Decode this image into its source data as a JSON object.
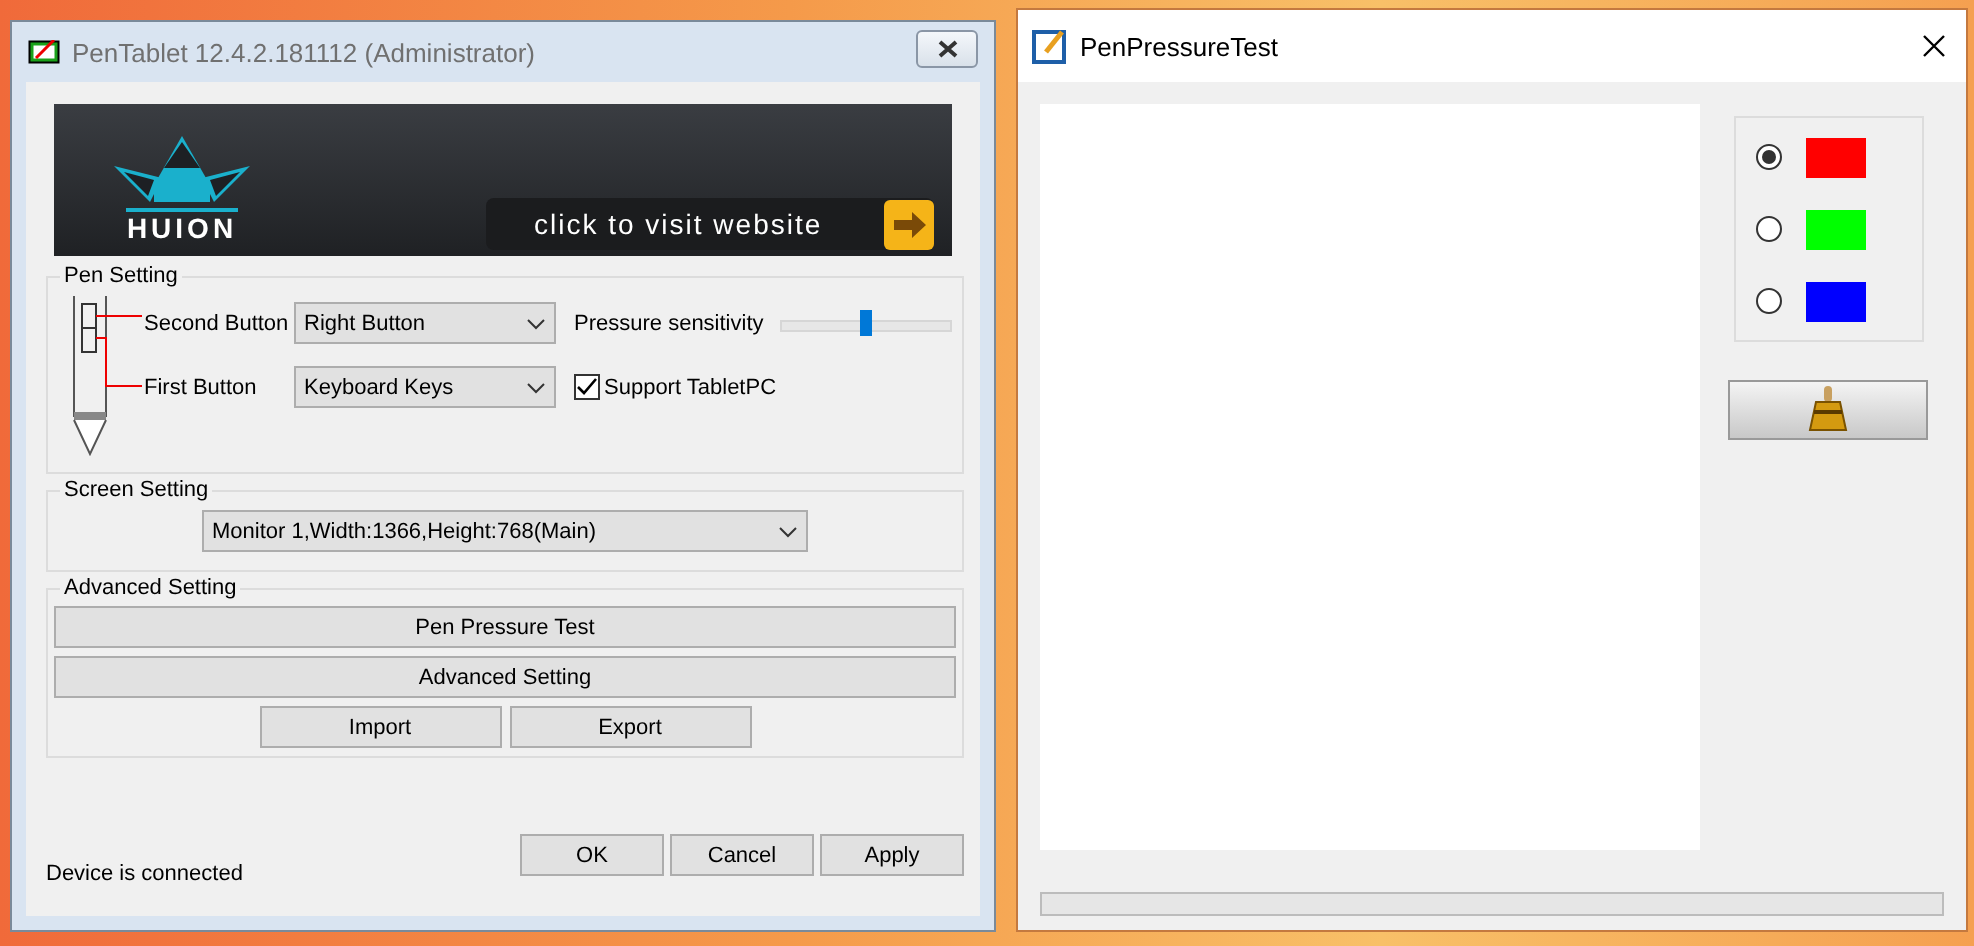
{
  "pentablet": {
    "window": {
      "title": "PenTablet 12.4.2.181112 (Administrator)"
    },
    "banner": {
      "logo": "HUION",
      "link": "click to visit website"
    },
    "pen_setting": {
      "title": "Pen Setting",
      "second_button": {
        "label": "Second Button",
        "value": "Right Button"
      },
      "first_button": {
        "label": "First Button",
        "value": "Keyboard Keys"
      },
      "pressure": {
        "label": "Pressure sensitivity",
        "level": 0.5
      },
      "tablet_pc": {
        "label": "Support TabletPC",
        "checked": true
      }
    },
    "screen_setting": {
      "title": "Screen Setting",
      "monitor": "Monitor 1,Width:1366,Height:768(Main)"
    },
    "advanced_setting": {
      "title": "Advanced Setting",
      "wide_buttons": [
        "Pen Pressure Test",
        "Advanced Setting"
      ],
      "small_buttons": [
        "Import",
        "Export"
      ]
    },
    "status": "Device is connected",
    "buttons": [
      "OK",
      "Cancel",
      "Apply"
    ]
  },
  "pressure_test": {
    "window": {
      "title": "PenPressureTest"
    },
    "colors": [
      {
        "color": "#ff0000",
        "selected": true
      },
      {
        "color": "#00ff00",
        "selected": false
      },
      {
        "color": "#0000ff",
        "selected": false
      }
    ],
    "progress": {
      "level": 0
    }
  }
}
